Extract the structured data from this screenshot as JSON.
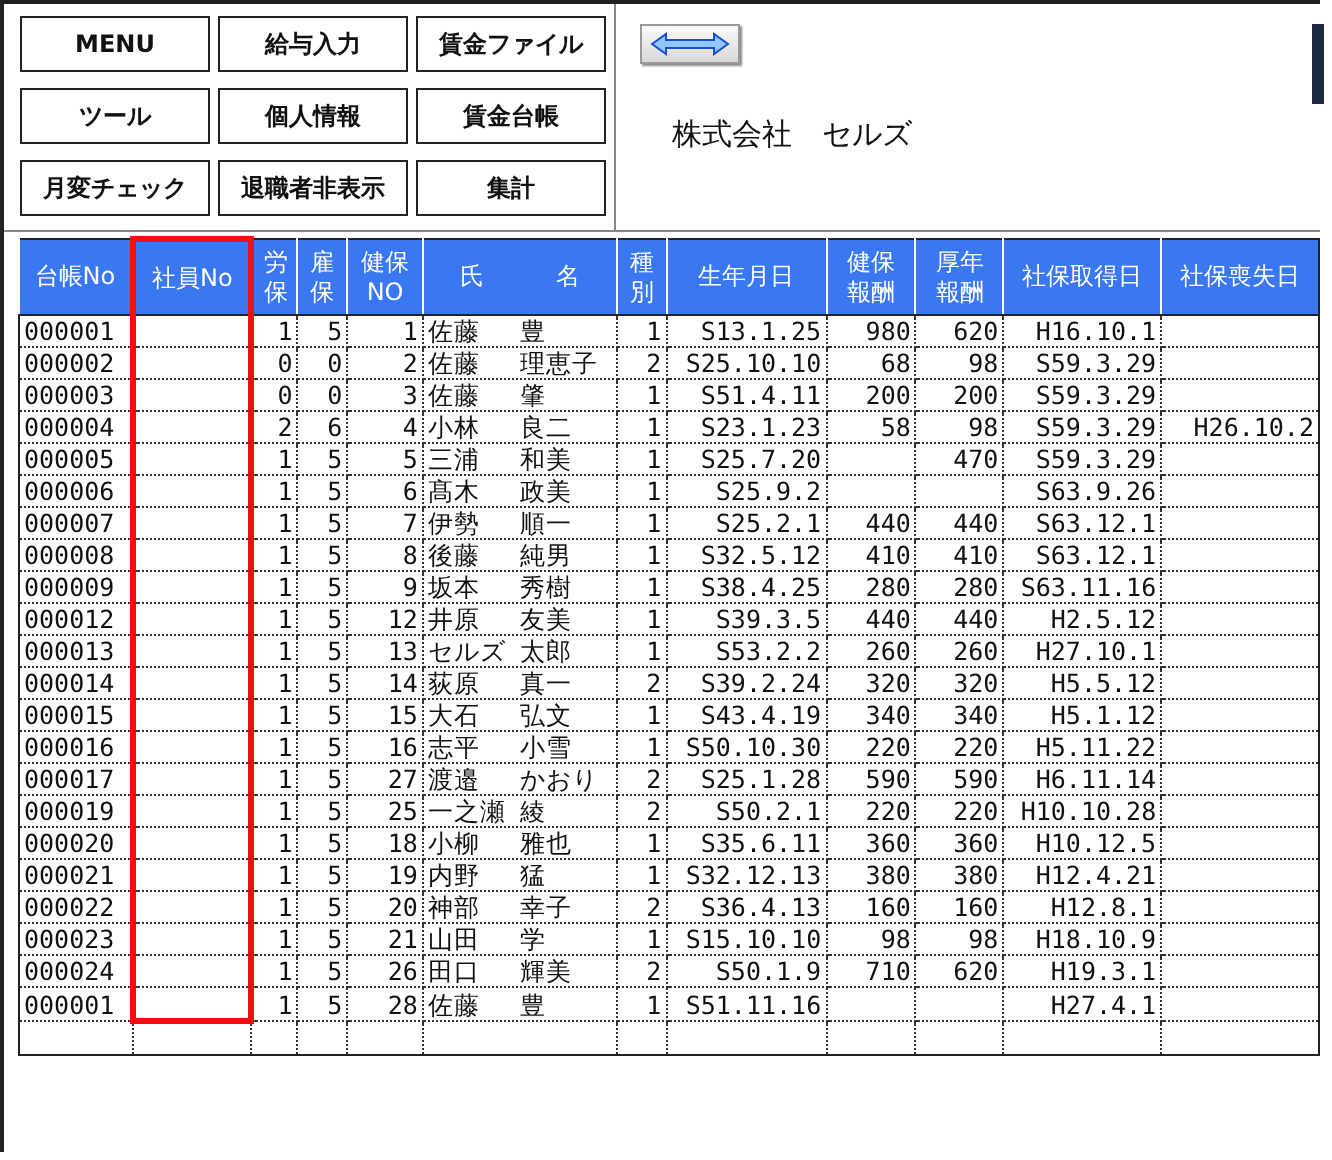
{
  "menu_buttons": [
    "MENU",
    "給与入力",
    "賃金ファイル",
    "ツール",
    "個人情報",
    "賃金台帳",
    "月変チェック",
    "退職者非表示",
    "集計"
  ],
  "company_name": "株式会社　セルズ",
  "table": {
    "columns": [
      {
        "lines": [
          "台帳No"
        ],
        "highlighted": false
      },
      {
        "lines": [
          "社員No"
        ],
        "highlighted": true
      },
      {
        "lines": [
          "労",
          "保"
        ],
        "highlighted": false
      },
      {
        "lines": [
          "雇",
          "保"
        ],
        "highlighted": false
      },
      {
        "lines": [
          "健保",
          "NO"
        ],
        "highlighted": false
      },
      {
        "lines": [
          "氏",
          "名"
        ],
        "highlighted": false
      },
      {
        "lines": [
          "種",
          "別"
        ],
        "highlighted": false
      },
      {
        "lines": [
          "生年月日"
        ],
        "highlighted": false
      },
      {
        "lines": [
          "健保",
          "報酬"
        ],
        "highlighted": false
      },
      {
        "lines": [
          "厚年",
          "報酬"
        ],
        "highlighted": false
      },
      {
        "lines": [
          "社保取得日"
        ],
        "highlighted": false
      },
      {
        "lines": [
          "社保喪失日"
        ],
        "highlighted": false
      }
    ],
    "rows": [
      {
        "ledger_no": "000001",
        "labor": "1",
        "employment": "5",
        "health_no": "1",
        "surname": "佐藤",
        "given_name": "豊",
        "category": "1",
        "birth": "S13.1.25",
        "health_pay": "980",
        "pension_pay": "620",
        "acquired": "H16.10.1"
      },
      {
        "ledger_no": "000002",
        "labor": "0",
        "employment": "0",
        "health_no": "2",
        "surname": "佐藤",
        "given_name": "理恵子",
        "category": "2",
        "birth": "S25.10.10",
        "health_pay": "68",
        "pension_pay": "98",
        "acquired": "S59.3.29"
      },
      {
        "ledger_no": "000003",
        "labor": "0",
        "employment": "0",
        "health_no": "3",
        "surname": "佐藤",
        "given_name": "肇",
        "category": "1",
        "birth": "S51.4.11",
        "health_pay": "200",
        "pension_pay": "200",
        "acquired": "S59.3.29"
      },
      {
        "ledger_no": "000004",
        "labor": "2",
        "employment": "6",
        "health_no": "4",
        "surname": "小林",
        "given_name": "良二",
        "category": "1",
        "birth": "S23.1.23",
        "health_pay": "58",
        "pension_pay": "98",
        "acquired": "S59.3.29",
        "lost": "H26.10.2"
      },
      {
        "ledger_no": "000005",
        "labor": "1",
        "employment": "5",
        "health_no": "5",
        "surname": "三浦",
        "given_name": "和美",
        "category": "1",
        "birth": "S25.7.20",
        "pension_pay": "470",
        "acquired": "S59.3.29"
      },
      {
        "ledger_no": "000006",
        "labor": "1",
        "employment": "5",
        "health_no": "6",
        "surname": "髙木",
        "given_name": "政美",
        "category": "1",
        "birth": "S25.9.2",
        "acquired": "S63.9.26"
      },
      {
        "ledger_no": "000007",
        "labor": "1",
        "employment": "5",
        "health_no": "7",
        "surname": "伊勢",
        "given_name": "順一",
        "category": "1",
        "birth": "S25.2.1",
        "health_pay": "440",
        "pension_pay": "440",
        "acquired": "S63.12.1"
      },
      {
        "ledger_no": "000008",
        "labor": "1",
        "employment": "5",
        "health_no": "8",
        "surname": "後藤",
        "given_name": "純男",
        "category": "1",
        "birth": "S32.5.12",
        "health_pay": "410",
        "pension_pay": "410",
        "acquired": "S63.12.1"
      },
      {
        "ledger_no": "000009",
        "labor": "1",
        "employment": "5",
        "health_no": "9",
        "surname": "坂本",
        "given_name": "秀樹",
        "category": "1",
        "birth": "S38.4.25",
        "health_pay": "280",
        "pension_pay": "280",
        "acquired": "S63.11.16"
      },
      {
        "ledger_no": "000012",
        "labor": "1",
        "employment": "5",
        "health_no": "12",
        "surname": "井原",
        "given_name": "友美",
        "category": "1",
        "birth": "S39.3.5",
        "health_pay": "440",
        "pension_pay": "440",
        "acquired": "H2.5.12"
      },
      {
        "ledger_no": "000013",
        "labor": "1",
        "employment": "5",
        "health_no": "13",
        "surname": "セルズ",
        "given_name": "太郎",
        "category": "1",
        "birth": "S53.2.2",
        "health_pay": "260",
        "pension_pay": "260",
        "acquired": "H27.10.1"
      },
      {
        "ledger_no": "000014",
        "labor": "1",
        "employment": "5",
        "health_no": "14",
        "surname": "荻原",
        "given_name": "真一",
        "category": "2",
        "birth": "S39.2.24",
        "health_pay": "320",
        "pension_pay": "320",
        "acquired": "H5.5.12"
      },
      {
        "ledger_no": "000015",
        "labor": "1",
        "employment": "5",
        "health_no": "15",
        "surname": "大石",
        "given_name": "弘文",
        "category": "1",
        "birth": "S43.4.19",
        "health_pay": "340",
        "pension_pay": "340",
        "acquired": "H5.1.12"
      },
      {
        "ledger_no": "000016",
        "labor": "1",
        "employment": "5",
        "health_no": "16",
        "surname": "志平",
        "given_name": "小雪",
        "category": "1",
        "birth": "S50.10.30",
        "health_pay": "220",
        "pension_pay": "220",
        "acquired": "H5.11.22"
      },
      {
        "ledger_no": "000017",
        "labor": "1",
        "employment": "5",
        "health_no": "27",
        "surname": "渡邉",
        "given_name": "かおり",
        "category": "2",
        "birth": "S25.1.28",
        "health_pay": "590",
        "pension_pay": "590",
        "acquired": "H6.11.14"
      },
      {
        "ledger_no": "000019",
        "labor": "1",
        "employment": "5",
        "health_no": "25",
        "surname": "一之瀬",
        "given_name": "綾",
        "category": "2",
        "birth": "S50.2.1",
        "health_pay": "220",
        "pension_pay": "220",
        "acquired": "H10.10.28"
      },
      {
        "ledger_no": "000020",
        "labor": "1",
        "employment": "5",
        "health_no": "18",
        "surname": "小柳",
        "given_name": "雅也",
        "category": "1",
        "birth": "S35.6.11",
        "health_pay": "360",
        "pension_pay": "360",
        "acquired": "H10.12.5"
      },
      {
        "ledger_no": "000021",
        "labor": "1",
        "employment": "5",
        "health_no": "19",
        "surname": "内野",
        "given_name": "猛",
        "category": "1",
        "birth": "S32.12.13",
        "health_pay": "380",
        "pension_pay": "380",
        "acquired": "H12.4.21"
      },
      {
        "ledger_no": "000022",
        "labor": "1",
        "employment": "5",
        "health_no": "20",
        "surname": "神部",
        "given_name": "幸子",
        "category": "2",
        "birth": "S36.4.13",
        "health_pay": "160",
        "pension_pay": "160",
        "acquired": "H12.8.1"
      },
      {
        "ledger_no": "000023",
        "labor": "1",
        "employment": "5",
        "health_no": "21",
        "surname": "山田",
        "given_name": "学",
        "category": "1",
        "birth": "S15.10.10",
        "health_pay": "98",
        "pension_pay": "98",
        "acquired": "H18.10.9"
      },
      {
        "ledger_no": "000024",
        "labor": "1",
        "employment": "5",
        "health_no": "26",
        "surname": "田口",
        "given_name": "輝美",
        "category": "2",
        "birth": "S50.1.9",
        "health_pay": "710",
        "pension_pay": "620",
        "acquired": "H19.3.1"
      },
      {
        "ledger_no": "000001",
        "labor": "1",
        "employment": "5",
        "health_no": "28",
        "surname": "佐藤",
        "given_name": "豊",
        "category": "1",
        "birth": "S51.11.16",
        "acquired": "H27.4.1"
      }
    ]
  }
}
